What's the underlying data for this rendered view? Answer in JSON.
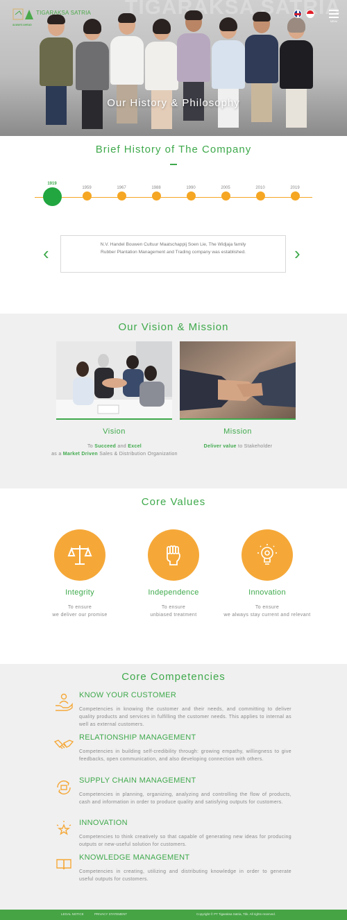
{
  "header": {
    "logo_text": "TIGARAKSA SATRIA",
    "logo_tagline": "ALWAYS AHEAD",
    "menu_label": "MENU",
    "hero_title": "Our History & Philosophy"
  },
  "history": {
    "title": "Brief History of The Company",
    "timeline": [
      "1919",
      "1959",
      "1967",
      "1988",
      "1990",
      "2005",
      "2010",
      "2019"
    ],
    "active_index": 0,
    "description": "N.V. Handel Bouwen Cultuur Maatschappij Soen Lie, The Widjaja family Rubber Plantation Management and Trading company was established.",
    "prev_label": "‹",
    "next_label": "›"
  },
  "vision_mission": {
    "title": "Our Vision & Mission",
    "vision": {
      "title": "Vision",
      "t1": "To ",
      "b1": "Succeed",
      "t2": " and ",
      "b2": "Excel",
      "t3": "as a ",
      "b3": "Market Driven",
      "t4": " Sales & Distribution Organization"
    },
    "mission": {
      "title": "Mission",
      "b1": "Deliver value",
      "t1": " to Stakeholder"
    }
  },
  "core_values": {
    "title": "Core Values",
    "items": [
      {
        "icon": "scales-icon",
        "title": "Integrity",
        "line1": "To ensure",
        "line2": "we deliver our promise"
      },
      {
        "icon": "fist-icon",
        "title": "Independence",
        "line1": "To ensure",
        "line2": "unbiased treatment"
      },
      {
        "icon": "lightbulb-gear-icon",
        "title": "Innovation",
        "line1": "To ensure",
        "line2": "we always stay current and relevant"
      }
    ]
  },
  "competencies": {
    "title": "Core Competencies",
    "items": [
      {
        "icon": "hand-person-icon",
        "title": "KNOW YOUR CUSTOMER",
        "text": "Competencies in knowing the customer and their needs, and committing to deliver quality products and services in fulfilling the customer needs. This applies to internal as well as external customers."
      },
      {
        "icon": "handshake-icon",
        "title": "RELATIONSHIP MANAGEMENT",
        "text": "Competencies in building self-credibility through: growing empathy, willingness to give feedbacks, open communication, and also developing connection with others."
      },
      {
        "icon": "supply-cycle-icon",
        "title": "SUPPLY CHAIN MANAGEMENT",
        "text": "Competencies in planning, organizing, analyzing and controlling the flow of products, cash and information in order to produce quality and satisfying outputs for customers."
      },
      {
        "icon": "star-sparkle-icon",
        "title": "INNOVATION",
        "text": "Competencies to think creatively so that capable of generating new ideas for producing outputs or new-useful solution for customers."
      },
      {
        "icon": "open-book-icon",
        "title": "KNOWLEDGE MANAGEMENT",
        "text": "Competencies in creating, utilizing and distributing knowledge in order to generate useful outputs for customers."
      }
    ]
  },
  "footer": {
    "legal": "LEGAL NOTICE",
    "privacy": "PRIVACY STATEMENT",
    "copyright": "Copyright © PT Tigaraksa Satria, Tbk. All rights reserved."
  },
  "colors": {
    "brand_green": "#3ea94b",
    "accent_orange": "#f5a838",
    "footer_green": "#46a445",
    "section_gray": "#f0f0f0"
  }
}
